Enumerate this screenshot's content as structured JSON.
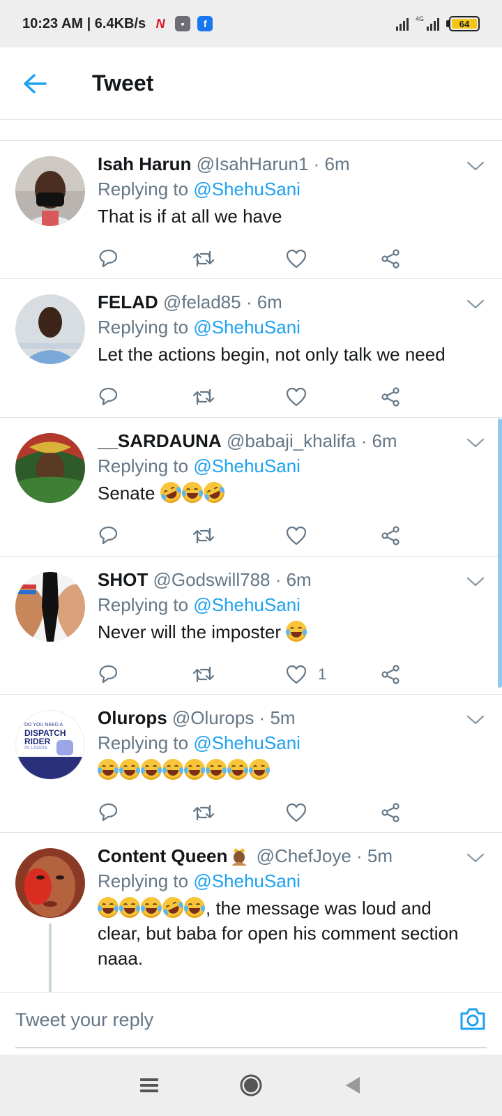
{
  "status_bar": {
    "time": "10:23 AM | 6.4KB/s",
    "network": "4G",
    "battery": "64",
    "icons": [
      "n-app-icon",
      "gallery-icon",
      "facebook-icon"
    ]
  },
  "header": {
    "title": "Tweet",
    "back_icon": "arrow-left-icon"
  },
  "colors": {
    "accent": "#1da1f2",
    "secondary_text": "#657786",
    "divider": "#dfe4e8"
  },
  "tweets": [
    {
      "name": "Isah Harun",
      "meta": "@IsahHarun1 · 6m",
      "replying_prefix": "Replying to ",
      "mention": "@ShehuSani",
      "text": "That is if at all we have",
      "like_count": ""
    },
    {
      "name": "FELAD",
      "meta": "@felad85 · 6m",
      "replying_prefix": "Replying to ",
      "mention": "@ShehuSani",
      "text": "Let the actions begin, not only talk we need",
      "like_count": ""
    },
    {
      "name": "__SARDAUNA",
      "meta": "@babaji_khalifa · 6m",
      "replying_prefix": "Replying to ",
      "mention": "@ShehuSani",
      "text": "Senate ",
      "like_count": ""
    },
    {
      "name": "SHOT",
      "meta": "@Godswill788 · 6m",
      "replying_prefix": "Replying to ",
      "mention": "@ShehuSani",
      "text": "Never will the imposter ",
      "like_count": "1"
    },
    {
      "name": "Olurops",
      "meta": "@Olurops · 5m",
      "replying_prefix": "Replying to ",
      "mention": "@ShehuSani",
      "text": "",
      "like_count": "",
      "avatar_text": [
        "DO YOU NEED A",
        "DISPATCH",
        "RIDER",
        "IN LAGOS"
      ]
    },
    {
      "name": "Content Queen",
      "meta": "@ChefJoye · 5m",
      "replying_prefix": "Replying to ",
      "mention": "@ShehuSani",
      "text": ", the message was loud and clear, but baba for open his comment section naaa.",
      "like_count": ""
    }
  ],
  "reply_bar": {
    "placeholder": "Tweet your reply",
    "camera_icon": "camera-icon"
  },
  "nav_bar": {
    "icons": [
      "menu-icon",
      "home-circle-icon",
      "back-triangle-icon"
    ]
  }
}
